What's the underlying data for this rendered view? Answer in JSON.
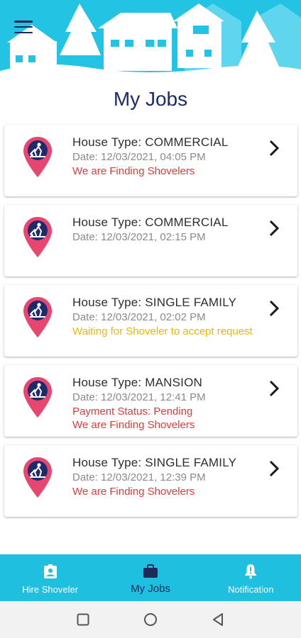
{
  "header": {
    "menu_icon": "hamburger-menu-icon",
    "colors": {
      "sky": "#23c3e3",
      "snow": "#ffffff"
    }
  },
  "page_title": "My Jobs",
  "jobs": [
    {
      "house_type": "House Type: COMMERCIAL",
      "date": "Date: 12/03/2021, 04:05 PM",
      "statuses": [
        {
          "text": "We are Finding Shovelers",
          "color": "red"
        }
      ]
    },
    {
      "house_type": "House Type: COMMERCIAL",
      "date": "Date: 12/03/2021, 02:15 PM",
      "statuses": []
    },
    {
      "house_type": "House Type: SINGLE FAMILY",
      "date": "Date: 12/03/2021, 02:02 PM",
      "statuses": [
        {
          "text": "Waiting for Shoveler to accept request",
          "color": "amber"
        }
      ]
    },
    {
      "house_type": "House Type: MANSION",
      "date": "Date: 12/03/2021, 12:41 PM",
      "statuses": [
        {
          "text": "Payment Status: Pending",
          "color": "red"
        },
        {
          "text": "We are Finding Shovelers",
          "color": "red"
        }
      ]
    },
    {
      "house_type": "House Type: SINGLE FAMILY",
      "date": "Date: 12/03/2021, 12:39 PM",
      "statuses": [
        {
          "text": "We are Finding Shovelers",
          "color": "red"
        }
      ]
    }
  ],
  "bottom_nav": {
    "hire_shoveler": "Hire Shoveler",
    "my_jobs": "My Jobs",
    "notification": "Notification"
  },
  "colors": {
    "accent": "#1fbfdf",
    "title": "#1f2a6b",
    "pin": "#e8456f",
    "status_red": "#e53b3b",
    "status_amber": "#f1b800"
  }
}
